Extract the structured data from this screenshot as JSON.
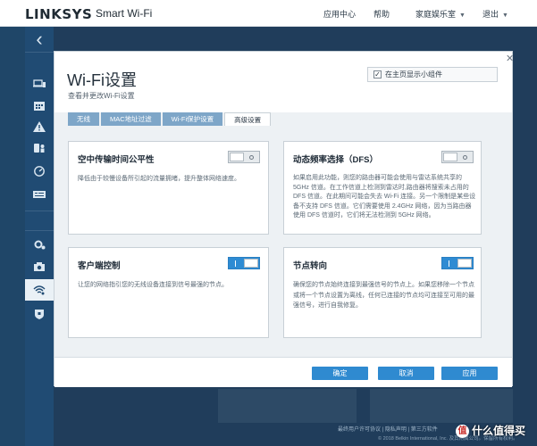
{
  "header": {
    "logo": "LINKSYS",
    "product": "Smart Wi-Fi",
    "nav": [
      {
        "label": "应用中心",
        "caret": false
      },
      {
        "label": "帮助",
        "caret": false
      },
      {
        "label": "家庭娱乐室",
        "caret": true
      },
      {
        "label": "退出",
        "caret": true
      }
    ]
  },
  "sidebar": {
    "collapse_glyph": "‹",
    "items": [
      {
        "icon": "devices-icon"
      },
      {
        "icon": "calendar-icon"
      },
      {
        "icon": "alert-icon"
      },
      {
        "icon": "parental-controls-icon"
      },
      {
        "icon": "speed-icon"
      },
      {
        "icon": "media-prioritization-icon"
      },
      {
        "icon": "settings-gear-icon"
      },
      {
        "icon": "camera-icon"
      },
      {
        "icon": "wifi-icon",
        "active": true
      },
      {
        "icon": "security-shield-icon"
      }
    ]
  },
  "modal": {
    "title": "Wi-Fi设置",
    "subtitle": "查看并更改Wi-Fi设置",
    "show_widget_label": "在主页显示小组件",
    "show_widget_checked": true,
    "close_glyph": "✕",
    "tabs": [
      "无线",
      "MAC地址过滤",
      "Wi-Fi保护设置",
      "高级设置"
    ],
    "active_tab": 3,
    "cards": [
      {
        "title": "空中传输时间公平性",
        "desc": "降低由于较慢设备所引起的流量拥堵，提升整体网络速度。",
        "toggle": "off"
      },
      {
        "title": "动态频率选择（DFS）",
        "desc": "如果启用此功能，则您的路由器可能会使用与雷达系统共享的 5GHz 信道。在工作信道上检测到雷达时,路由器将搜索未占用的 DFS 信道。在此期间可能会失去 Wi-Fi 连接。另一个限制是某些设备不支持 DFS 信道。它们需要使用 2.4GHz 网络，因为当路由器使用 DFS 信道时，它们将无法检测到 5GHz 网络。",
        "toggle": "off"
      },
      {
        "title": "客户端控制",
        "desc": "让您的网络指引您的无线设备连接到信号最强的节点。",
        "toggle": "on"
      },
      {
        "title": "节点转向",
        "desc": "确保您的节点始终连接到最强信号的节点上。如果您移除一个节点或将一个节点设置为离线，任何已连接的节点均可连接至可用的最强信号，进行自我修复。",
        "toggle": "on"
      }
    ],
    "buttons": {
      "ok": "确定",
      "cancel": "取消",
      "apply": "应用"
    }
  },
  "footer": {
    "links": "最终用户许可协议  |  隐私声明  |  第三方软件",
    "copyright": "© 2018 Belkin International, Inc. 及其附属公司。保留所有权利。",
    "watermark": "什么值得买"
  },
  "colors": {
    "accent": "#2f8ad0",
    "sidebar": "#204b73",
    "background": "#1f4668"
  }
}
